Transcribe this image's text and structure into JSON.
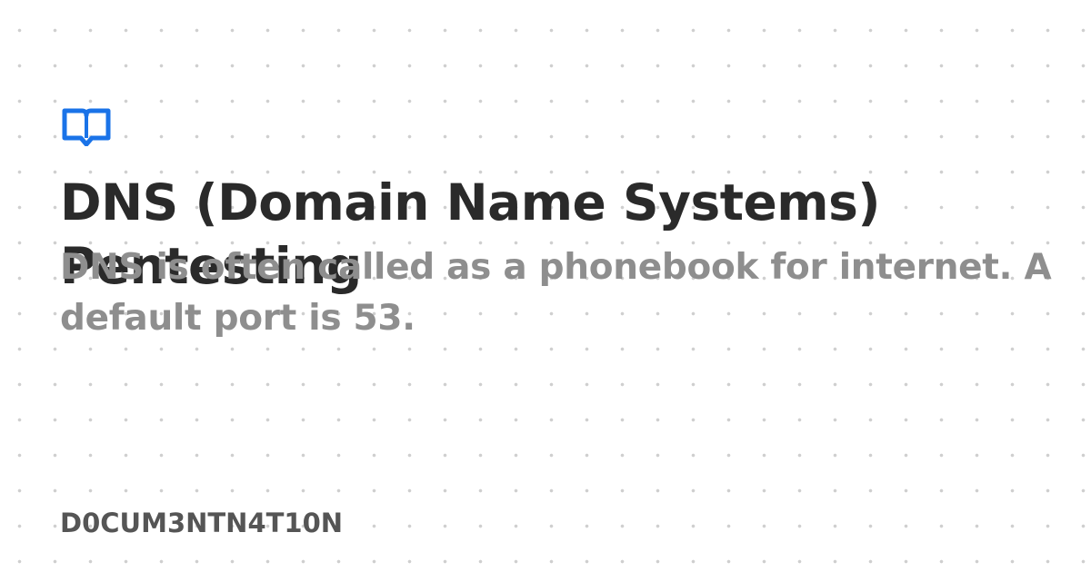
{
  "card": {
    "title": "DNS (Domain Name Systems) Pentesting",
    "description": "DNS is often called as a phonebook for internet. A default port is 53.",
    "site_name": "D0CUM3NTN4T10N",
    "logo_icon": "open-book-icon"
  },
  "colors": {
    "accent": "#1a73e8",
    "title": "#2a2a2a",
    "description": "#8e8e8e",
    "site_name": "#555555",
    "background_dots": "#cfcfcf"
  }
}
